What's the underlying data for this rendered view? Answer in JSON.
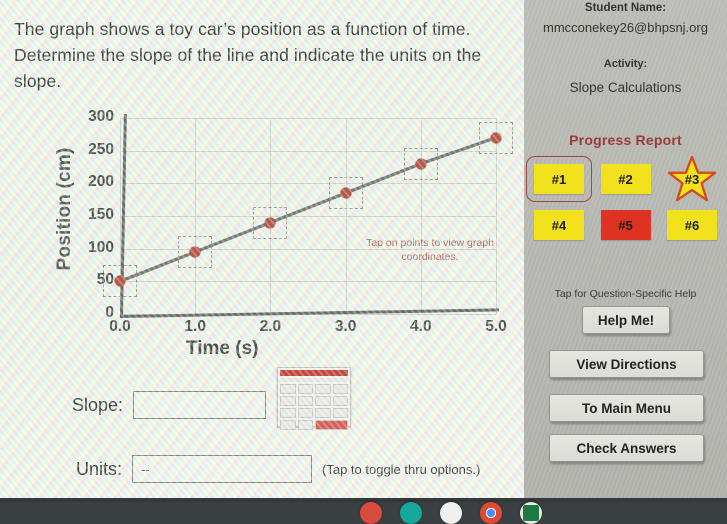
{
  "prompt": "The graph shows a toy car’s position as a function of time. Determine the slope of the line and indicate the units on the slope.",
  "chart_data": {
    "type": "line",
    "title": "",
    "xlabel": "Time (s)",
    "ylabel": "Position (cm)",
    "x": [
      0.0,
      1.0,
      2.0,
      3.0,
      4.0,
      5.0
    ],
    "values": [
      50,
      95,
      140,
      185,
      230,
      270
    ],
    "series": [
      {
        "name": "Position",
        "values": [
          50,
          95,
          140,
          185,
          230,
          270
        ]
      }
    ],
    "xticks": [
      "0.0",
      "1.0",
      "2.0",
      "3.0",
      "4.0",
      "5.0"
    ],
    "yticks": [
      "0",
      "50",
      "100",
      "150",
      "200",
      "250",
      "300"
    ],
    "xlim": [
      0.0,
      5.0
    ],
    "ylim": [
      0,
      300
    ],
    "grid": true,
    "legend": "none",
    "annotation": "Tap on points to view graph coordinates.",
    "point_color": "#b24a3c",
    "line_color": "#6b6f6a"
  },
  "answers": {
    "slope_label": "Slope:",
    "slope_value": "",
    "units_label": "Units:",
    "units_value": "--",
    "toggle_note": "(Tap to toggle thru options.)"
  },
  "panel": {
    "student_name_label": "Student Name:",
    "student_email": "mmcconekey26@bhpsnj.org",
    "activity_label": "Activity:",
    "activity_name": "Slope Calculations",
    "progress_title": "Progress Report",
    "progress_items": [
      {
        "label": "#1",
        "state": "current",
        "color": "#f2e21d"
      },
      {
        "label": "#2",
        "state": "pending",
        "color": "#f2e21d"
      },
      {
        "label": "#3",
        "state": "starred",
        "color": "#f2e21d"
      },
      {
        "label": "#4",
        "state": "pending",
        "color": "#f2e21d"
      },
      {
        "label": "#5",
        "state": "incorrect",
        "color": "#de3223"
      },
      {
        "label": "#6",
        "state": "pending",
        "color": "#f2e21d"
      }
    ],
    "help_note": "Tap for Question-Specific Help",
    "buttons": {
      "help": "Help Me!",
      "directions": "View Directions",
      "main_menu": "To Main Menu",
      "check": "Check Answers"
    }
  },
  "dock": {
    "icons": [
      "recorder-icon",
      "teal-app-icon",
      "white-app-icon",
      "chrome-icon",
      "excel-icon"
    ],
    "colors": [
      "#d94b3e",
      "#16a79b",
      "#f0f0ee",
      "#e04a32",
      "#e9eae4"
    ]
  }
}
